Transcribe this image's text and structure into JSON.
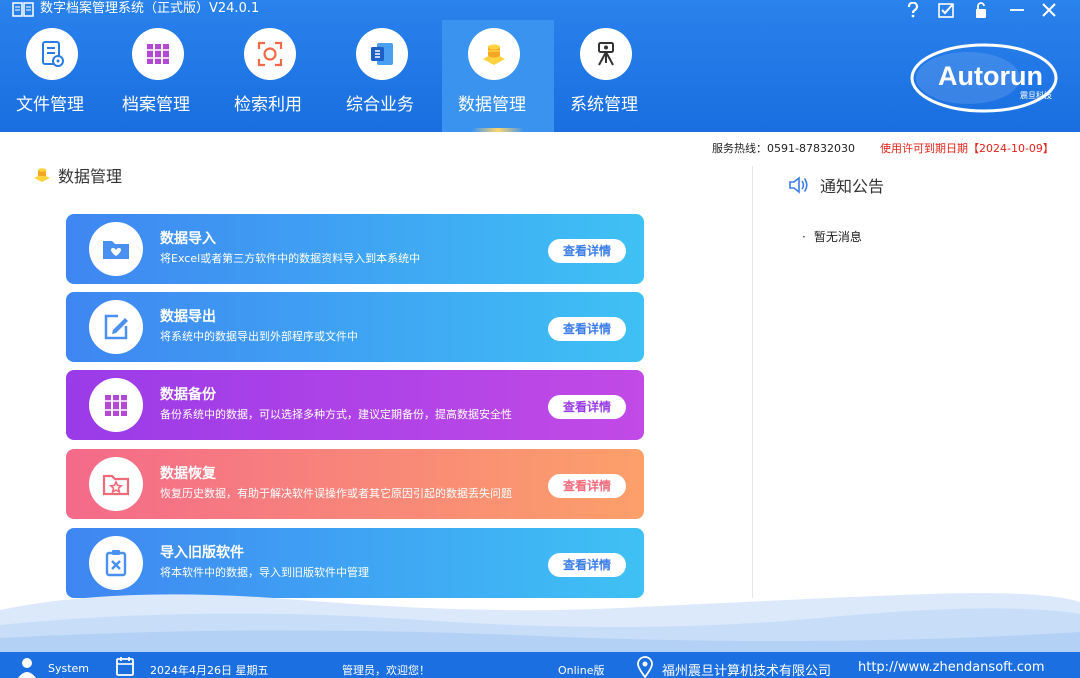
{
  "app": {
    "title": "数字档案管理系统（正式版）V24.0.1"
  },
  "nav": [
    {
      "label": "文件管理",
      "icon": "document-icon"
    },
    {
      "label": "档案管理",
      "icon": "archive-books-icon"
    },
    {
      "label": "检索利用",
      "icon": "scan-search-icon"
    },
    {
      "label": "综合业务",
      "icon": "office-doc-icon"
    },
    {
      "label": "数据管理",
      "icon": "database-stack-icon",
      "active": true
    },
    {
      "label": "系统管理",
      "icon": "system-tripod-icon"
    }
  ],
  "logo": {
    "brand": "Autorun",
    "sub": "震旦科技"
  },
  "service": {
    "hotline": "服务热线：0591-87832030",
    "license": "使用许可到期日期【2024-10-09】"
  },
  "main": {
    "section_title": "数据管理",
    "cards": [
      {
        "title": "数据导入",
        "desc": "将Excel或者第三方软件中的数据资料导入到本系统中",
        "button": "查看详情",
        "theme": "blue",
        "icon": "folder-heart-icon",
        "btn_color": "#3b7de8"
      },
      {
        "title": "数据导出",
        "desc": "将系统中的数据导出到外部程序或文件中",
        "button": "查看详情",
        "theme": "blue",
        "icon": "edit-export-icon",
        "btn_color": "#3b7de8"
      },
      {
        "title": "数据备份",
        "desc": "备份系统中的数据，可以选择多种方式，建议定期备份，提高数据安全性",
        "button": "查看详情",
        "theme": "purple",
        "icon": "books-backup-icon",
        "btn_color": "#9a3be8"
      },
      {
        "title": "数据恢复",
        "desc": "恢复历史数据，有助于解决软件误操作或者其它原因引起的数据丢失问题",
        "button": "查看详情",
        "theme": "orange",
        "icon": "folder-star-icon",
        "btn_color": "#f06a7a"
      },
      {
        "title": "导入旧版软件",
        "desc": "将本软件中的数据，导入到旧版软件中管理",
        "button": "查看详情",
        "theme": "blue",
        "icon": "clipboard-x-icon",
        "btn_color": "#3b7de8"
      }
    ]
  },
  "notice": {
    "title": "通知公告",
    "items": [
      "暂无消息"
    ]
  },
  "status": {
    "user": "System",
    "date": "2024年4月26日 星期五",
    "welcome": "管理员，欢迎您！",
    "edition": "Online版",
    "company": "福州震旦计算机技术有限公司",
    "website": "http://www.zhendansoft.com"
  },
  "colors": {
    "header": "#1a6ee0",
    "accent": "#3b93f0",
    "license": "#e2231a"
  }
}
